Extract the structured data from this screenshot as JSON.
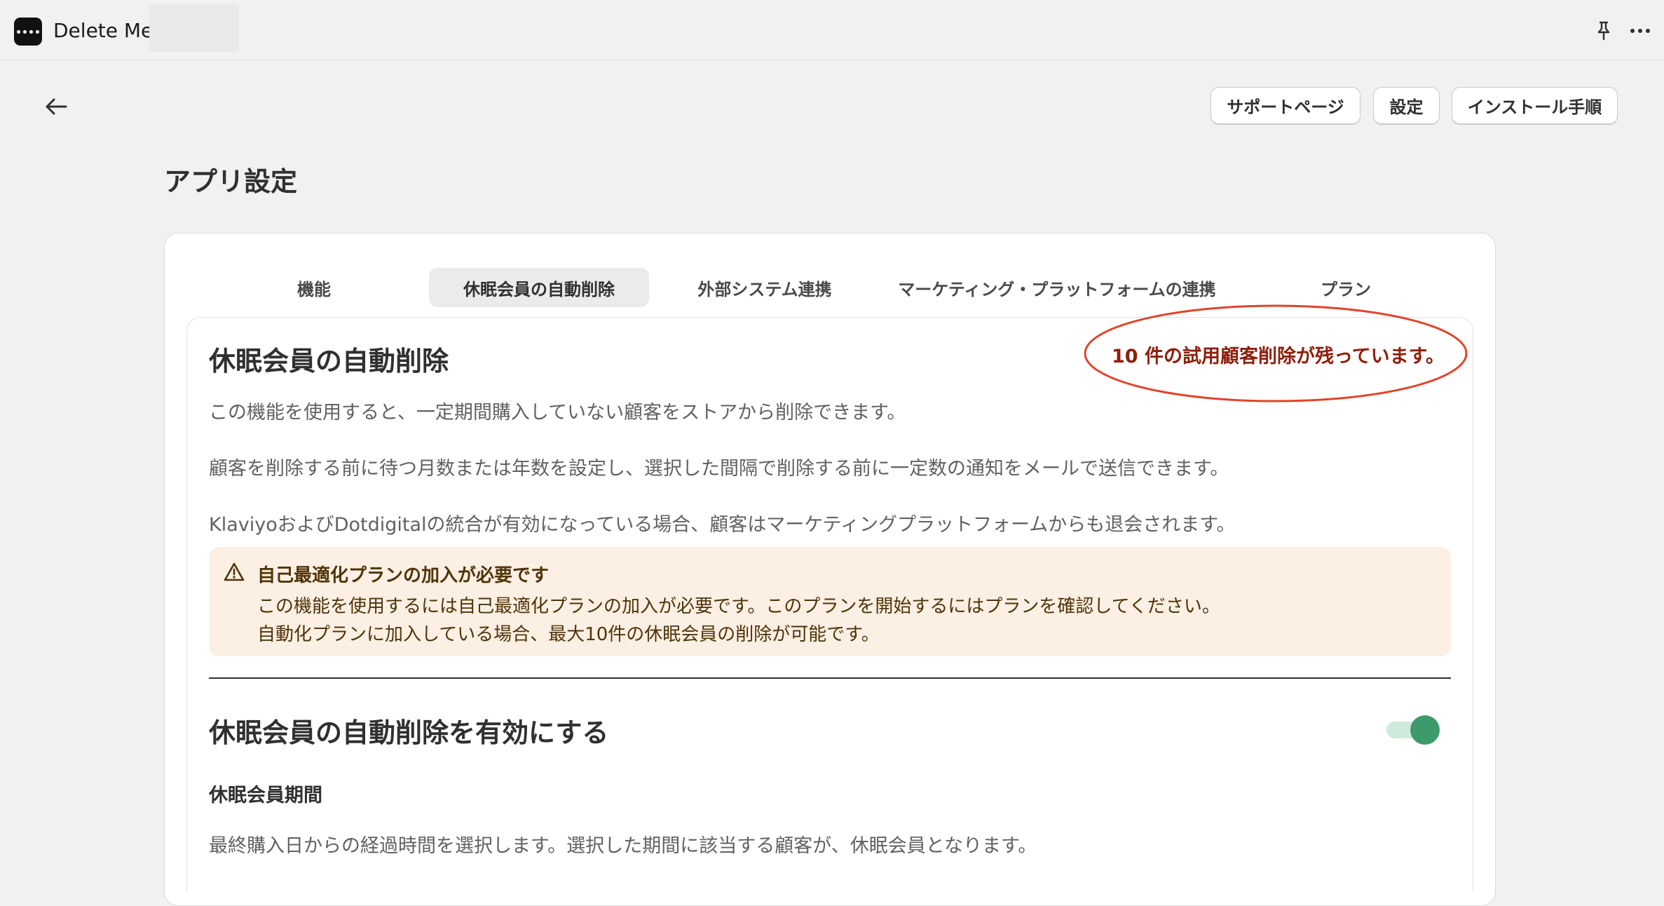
{
  "app": {
    "title": "Delete Me"
  },
  "header": {
    "support_label": "サポートページ",
    "settings_label": "設定",
    "install_label": "インストール手順"
  },
  "page": {
    "title": "アプリ設定"
  },
  "tabs": [
    {
      "label": "機能"
    },
    {
      "label": "休眠会員の自動削除",
      "active": true
    },
    {
      "label": "外部システム連携"
    },
    {
      "label": "マーケティング・プラットフォームの連携"
    },
    {
      "label": "プラン"
    }
  ],
  "section": {
    "title": "休眠会員の自動削除",
    "trial_note": "10 件の試用顧客削除が残っています。",
    "desc1": "この機能を使用すると、一定期間購入していない顧客をストアから削除できます。",
    "desc2": "顧客を削除する前に待つ月数または年数を設定し、選択した間隔で削除する前に一定数の通知をメールで送信できます。",
    "desc3": "KlaviyoおよびDotdigitalの統合が有効になっている場合、顧客はマーケティングプラットフォームからも退会されます。"
  },
  "banner": {
    "title": "自己最適化プランの加入が必要です",
    "line1": "この機能を使用するには自己最適化プランの加入が必要です。このプランを開始するにはプランを確認してください。",
    "line2": "自動化プランに加入している場合、最大10件の休眠会員の削除が可能です。",
    "icon": "warning-icon"
  },
  "enable": {
    "title": "休眠会員の自動削除を有効にする",
    "enabled": true
  },
  "period": {
    "title": "休眠会員期間",
    "desc": "最終購入日からの経過時間を選択します。選択した期間に該当する顧客が、休眠会員となります。"
  },
  "colors": {
    "annotation": "#e0452a",
    "toggle_on": "#3d9a6a",
    "banner_bg": "#fcefe3"
  }
}
